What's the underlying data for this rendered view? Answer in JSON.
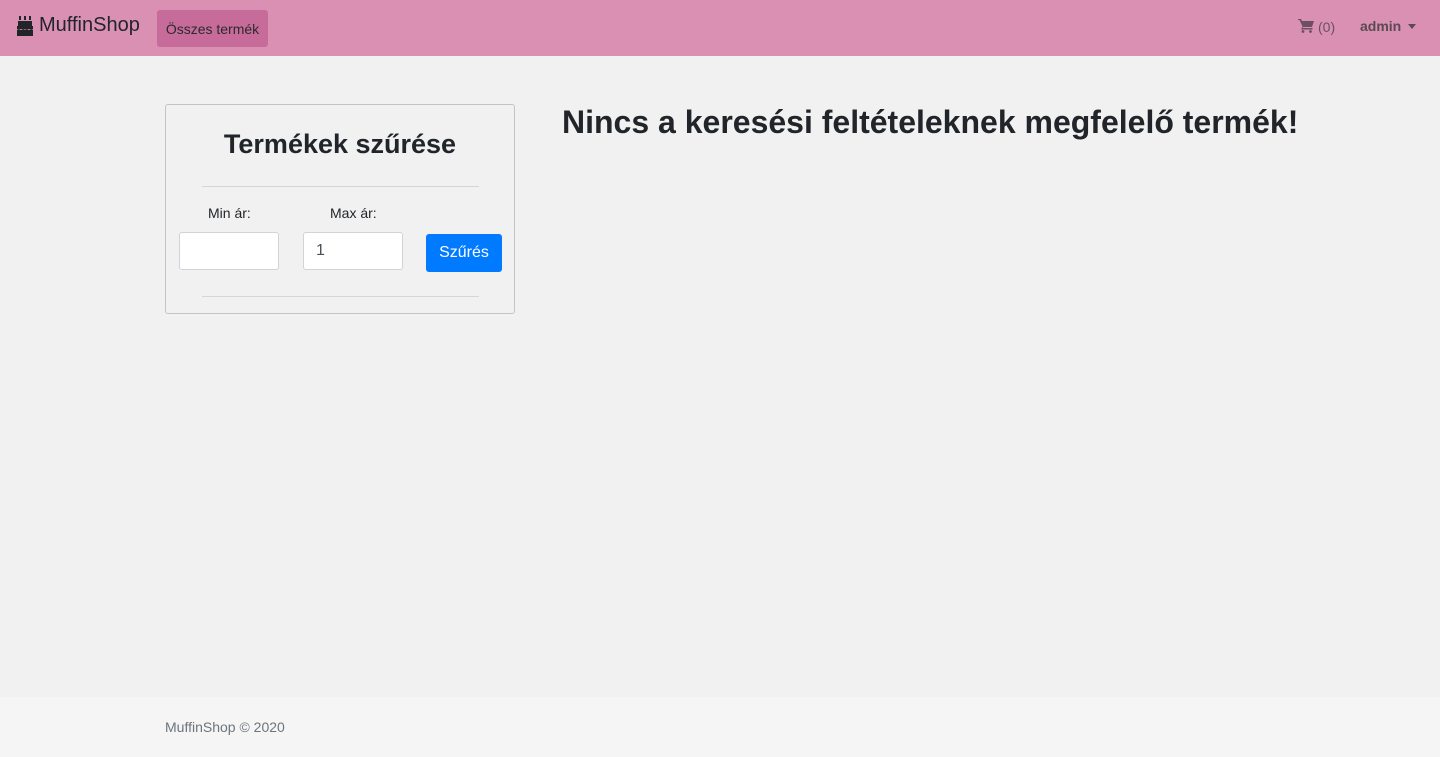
{
  "navbar": {
    "brand": "MuffinShop",
    "brand_icon": "birthday-cake-icon",
    "active_link": "Összes termék",
    "cart_icon": "shopping-cart-icon",
    "cart_count": "(0)",
    "user": "admin",
    "bg_color": "#da90b3",
    "active_bg_color": "#c76b9a"
  },
  "filter": {
    "title": "Termékek szűrése",
    "min_label": "Min ár:",
    "min_value": "",
    "max_label": "Max ár:",
    "max_value": "1",
    "button_label": "Szűrés",
    "button_color": "#007bff"
  },
  "main": {
    "message": "Nincs a keresési feltételeknek megfelelő termék!"
  },
  "footer": {
    "text": "MuffinShop © 2020"
  }
}
